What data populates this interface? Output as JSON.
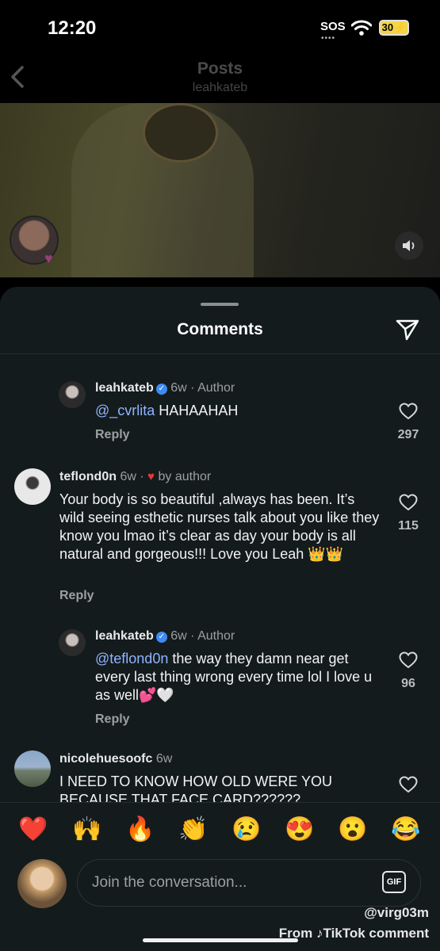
{
  "status": {
    "time": "12:20",
    "sos": "SOS",
    "battery": "30"
  },
  "header": {
    "title": "Posts",
    "subtitle": "leahkateb"
  },
  "sheet": {
    "title": "Comments"
  },
  "comments": [
    {
      "user": "leahkateb",
      "time": "6w",
      "tag": "Author",
      "mention": "@_cvrlita",
      "text": " HAHAAHAH",
      "reply": "Reply",
      "likes": "297"
    },
    {
      "user": "teflond0n",
      "time": "6w",
      "tag": "by author",
      "text": "Your body is so beautiful ,always has been. It’s wild seeing esthetic nurses talk about you like they know you lmao it’s clear as day your body is all natural and gorgeous!!! Love you Leah 👑👑",
      "reply": "Reply",
      "likes": "115"
    },
    {
      "user": "leahkateb",
      "time": "6w",
      "tag": "Author",
      "mention": "@teflond0n",
      "text": " the way they damn near get every last thing wrong every time lol I love u as well💕🤍",
      "reply": "Reply",
      "likes": "96"
    },
    {
      "user": "nicolehuesoofc",
      "time": "6w",
      "text": "I NEED TO KNOW HOW OLD WERE YOU BECAUSE THAT FACE CARD??????"
    }
  ],
  "reactions": [
    "❤️",
    "🙌",
    "🔥",
    "👏",
    "😢",
    "😍",
    "😮",
    "😂"
  ],
  "composer": {
    "placeholder": "Join the conversation...",
    "gif": "GIF"
  },
  "watermark": {
    "user": "@virg03m",
    "from": "From ♪TikTok comment"
  }
}
